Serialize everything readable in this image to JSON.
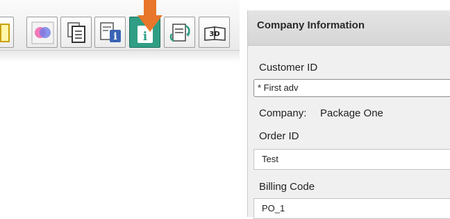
{
  "toolbar": {
    "buttons": [
      {
        "name": "document-frame-icon",
        "active": false
      },
      {
        "name": "color-overlay-icon",
        "active": false
      },
      {
        "name": "copy-pages-icon",
        "active": false
      },
      {
        "name": "document-info-icon",
        "active": false
      },
      {
        "name": "upload-info-icon",
        "active": true
      },
      {
        "name": "refresh-document-icon",
        "active": false
      },
      {
        "name": "3d-book-icon",
        "active": false
      }
    ],
    "indicator_color": "#e8762b",
    "active_color": "#2f9e84"
  },
  "panel": {
    "title": "Company Information",
    "customer_id": {
      "label": "Customer ID",
      "value": "* First adv"
    },
    "company": {
      "label": "Company:",
      "value": "Package One"
    },
    "order_id": {
      "label": "Order ID",
      "value": "Test"
    },
    "billing_code": {
      "label": "Billing Code",
      "value": "PO_1"
    }
  }
}
